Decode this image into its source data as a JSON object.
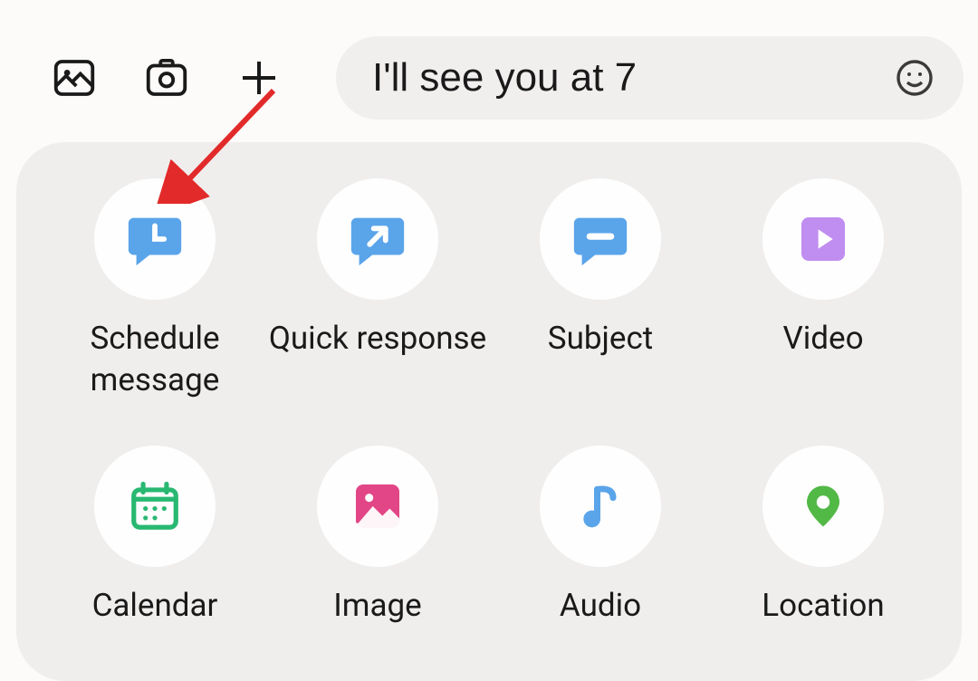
{
  "input": {
    "value": "I'll see you at 7",
    "placeholder": ""
  },
  "options": [
    {
      "label": "Schedule\nmessage"
    },
    {
      "label": "Quick response"
    },
    {
      "label": "Subject"
    },
    {
      "label": "Video"
    },
    {
      "label": "Calendar"
    },
    {
      "label": "Image"
    },
    {
      "label": "Audio"
    },
    {
      "label": "Location"
    }
  ],
  "colors": {
    "bubble": "#5aa4ea",
    "video": "#c08df0",
    "calendar": "#28b871",
    "image": "#e24686",
    "pin": "#52b846",
    "arrow": "#e22a2a",
    "send": "#4d4745"
  }
}
